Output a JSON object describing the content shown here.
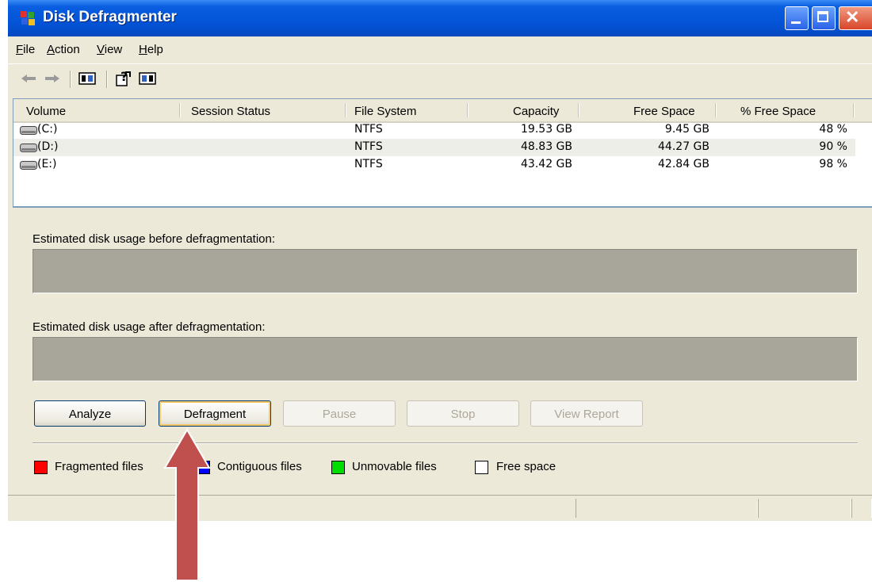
{
  "window": {
    "title": "Disk Defragmenter"
  },
  "menu": {
    "file": {
      "u": "F",
      "rest": "ile"
    },
    "action": {
      "u": "A",
      "rest": "ction"
    },
    "view": {
      "u": "V",
      "rest": "iew"
    },
    "help": {
      "u": "H",
      "rest": "elp"
    }
  },
  "toolbar_icons": [
    "back-arrow-icon",
    "forward-arrow-icon",
    "show-hide-console-tree-icon",
    "help-icon",
    "properties-pane-icon"
  ],
  "table": {
    "columns": [
      "Volume",
      "Session Status",
      "File System",
      "Capacity",
      "Free Space",
      "% Free Space"
    ],
    "rows": [
      {
        "volume": "(C:)",
        "status": "",
        "fs": "NTFS",
        "capacity": "19.53 GB",
        "free": "9.45 GB",
        "pct": "48 %"
      },
      {
        "volume": "(D:)",
        "status": "",
        "fs": "NTFS",
        "capacity": "48.83 GB",
        "free": "44.27 GB",
        "pct": "90 %"
      },
      {
        "volume": "(E:)",
        "status": "",
        "fs": "NTFS",
        "capacity": "43.42 GB",
        "free": "42.84 GB",
        "pct": "98 %"
      }
    ]
  },
  "labels": {
    "before": "Estimated disk usage before defragmentation:",
    "after": "Estimated disk usage after defragmentation:"
  },
  "buttons": {
    "analyze": "Analyze",
    "defragment": "Defragment",
    "pause": "Pause",
    "stop": "Stop",
    "view_report": "View Report"
  },
  "legend": {
    "fragmented": "Fragmented files",
    "contiguous": "Contiguous files",
    "unmovable": "Unmovable files",
    "free": "Free space"
  },
  "colors": {
    "fragmented": "#ff0000",
    "contiguous": "#0000ff",
    "unmovable": "#00dd00",
    "free": "#ffffff",
    "arrow": "#c0504d"
  }
}
